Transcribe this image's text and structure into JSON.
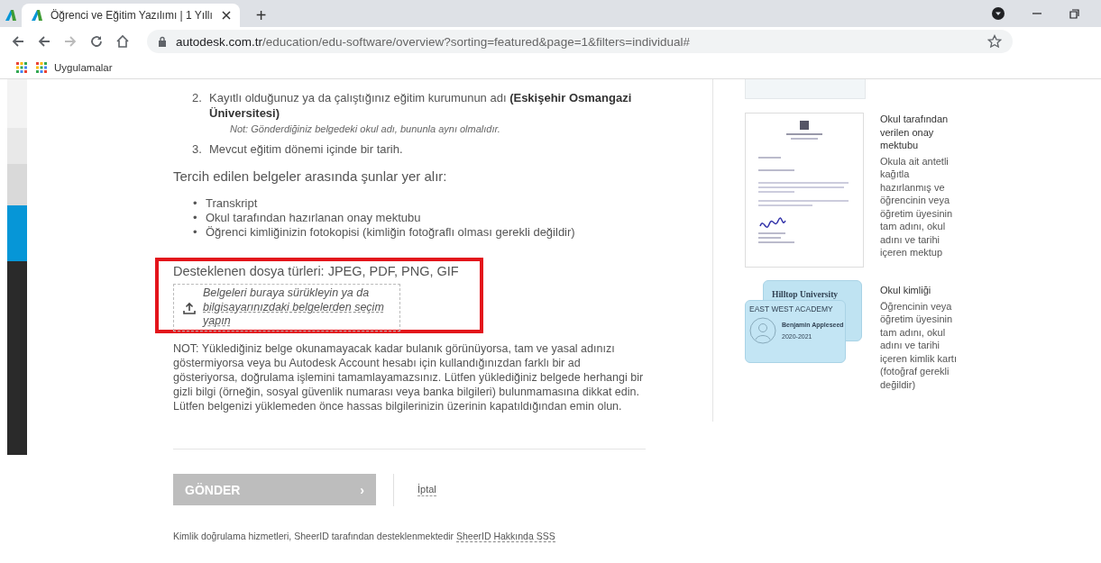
{
  "browser": {
    "tabs": [
      {
        "selected": false
      },
      {
        "title": "Öğrenci ve Eğitim Yazılımı | 1 Yıllı",
        "selected": true
      }
    ],
    "new_tab": "+",
    "address": {
      "domain": "autodesk.com.tr",
      "path": "/education/edu-software/overview?sorting=featured&page=1&filters=individual#"
    },
    "bookmarks": [
      {
        "label": "Uygulamalar"
      }
    ]
  },
  "requirements": [
    {
      "number": "2.",
      "text": "Kayıtlı olduğunuz ya da çalıştığınız eğitim kurumunun adı **(Eskişehir Osmangazi Üniversitesi)**",
      "note": "Not: Gönderdiğiniz belgedeki okul adı, bununla aynı olmalıdır."
    },
    {
      "number": "3.",
      "text": "Mevcut eğitim dönemi içinde bir tarih."
    }
  ],
  "preferred": {
    "heading": "Tercih edilen belgeler arasında şunlar yer alır:",
    "bullet": "•",
    "items": [
      "Transkript",
      "Okul tarafından hazırlanan onay mektubu",
      "Öğrenci kimliğinizin fotokopisi (kimliğin fotoğraflı olması gerekli değildir)"
    ]
  },
  "upload": {
    "file_types": "Desteklenen dosya türleri: JPEG, PDF, PNG, GIF",
    "drop_text": "Belgeleri buraya sürükleyin ya da",
    "browse_link": "bilgisayarınızdaki belgelerden seçim yapın"
  },
  "notice": "NOT: Yüklediğiniz belge okunamayacak kadar bulanık görünüyorsa, tam ve yasal adınızı göstermiyorsa veya bu Autodesk Account hesabı için kullandığınızdan farklı bir ad gösteriyorsa, doğrulama işlemini tamamlayamazsınız. Lütfen yüklediğiniz belgede herhangi bir gizli bilgi (örneğin, sosyal güvenlik numarası veya banka bilgileri) bulunmamasına dikkat edin. Lütfen belgenizi yüklemeden önce hassas bilgilerinizin üzerinin kapatıldığından emin olun.",
  "actions": {
    "submit": {
      "label": "GÖNDER",
      "chevron": "›",
      "disabled": true
    },
    "cancel": "İptal"
  },
  "footer": {
    "text": "Kimlik doğrulama hizmetleri, SheerID tarafından desteklenmektedir",
    "link": "SheerID Hakkında SSS"
  },
  "examples": [
    {
      "kind": "partial"
    },
    {
      "kind": "letter",
      "title": "Okul tarafından verilen onay mektubu",
      "description": "Okula ait antetli kağıtla hazırlanmış ve öğrencinin veya öğretim üyesinin tam adını, okul adını ve tarihi içeren mektup"
    },
    {
      "kind": "idcard",
      "title": "Okul kimliği",
      "description": "Öğrencinin veya öğretim üyesinin tam adını, okul adını ve tarihi içeren kimlik kartı (fotoğraf gerekli değildir)",
      "card_back": "Hilltop University",
      "card_front": "EAST WEST ACADEMY",
      "holder": "Benjamin Appleseed",
      "years": "2020-2021"
    }
  ]
}
